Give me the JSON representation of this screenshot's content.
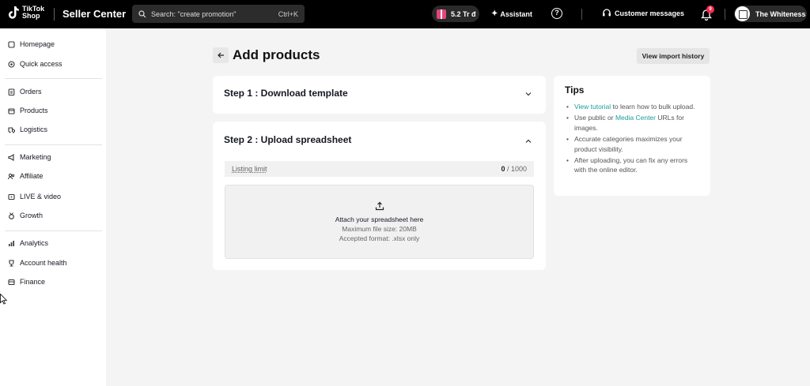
{
  "header": {
    "logo_line1": "TikTok",
    "logo_line2": "Shop",
    "brand": "Seller Center",
    "search_placeholder": "Search: \"create promotion\"",
    "search_shortcut": "Ctrl+K",
    "balance": "5.2 Tr đ",
    "assistant_label": "Assistant",
    "customer_messages_label": "Customer messages",
    "notification_count": "9",
    "shop_name": "The Whiteness",
    "accent_color": "#fe2c55"
  },
  "sidebar": {
    "items": [
      {
        "label": "Homepage",
        "icon": "home-icon"
      },
      {
        "label": "Quick access",
        "icon": "target-icon"
      },
      {
        "label": "Orders",
        "icon": "clipboard-icon"
      },
      {
        "label": "Products",
        "icon": "box-icon"
      },
      {
        "label": "Logistics",
        "icon": "truck-icon"
      },
      {
        "label": "Marketing",
        "icon": "megaphone-icon"
      },
      {
        "label": "Affiliate",
        "icon": "users-icon"
      },
      {
        "label": "LIVE & video",
        "icon": "live-icon"
      },
      {
        "label": "Growth",
        "icon": "medal-icon"
      },
      {
        "label": "Analytics",
        "icon": "chart-icon"
      },
      {
        "label": "Account health",
        "icon": "trophy-icon"
      },
      {
        "label": "Finance",
        "icon": "wallet-icon"
      }
    ]
  },
  "main": {
    "page_title": "Add products",
    "view_import_history": "View import history",
    "step1_title": "Step 1 : Download template",
    "step2_title": "Step 2 : Upload spreadsheet",
    "listing_limit_label": "Listing limit",
    "listing_limit_used": "0",
    "listing_limit_total": " / 1000",
    "upload_title": "Attach your spreadsheet here",
    "upload_max_size": "Maximum file size: 20MB",
    "upload_format": "Accepted format: .xlsx only"
  },
  "tips": {
    "title": "Tips",
    "tip1_link": "View tutorial",
    "tip1_text": " to learn how to bulk upload.",
    "tip2_pre": "Use public or ",
    "tip2_link": "Media Center",
    "tip2_post": " URLs for images.",
    "tip3": "Accurate categories maximizes your product visibility.",
    "tip4": "After uploading, you can fix any errors with the online editor.",
    "link_color": "#1a9e9a"
  }
}
